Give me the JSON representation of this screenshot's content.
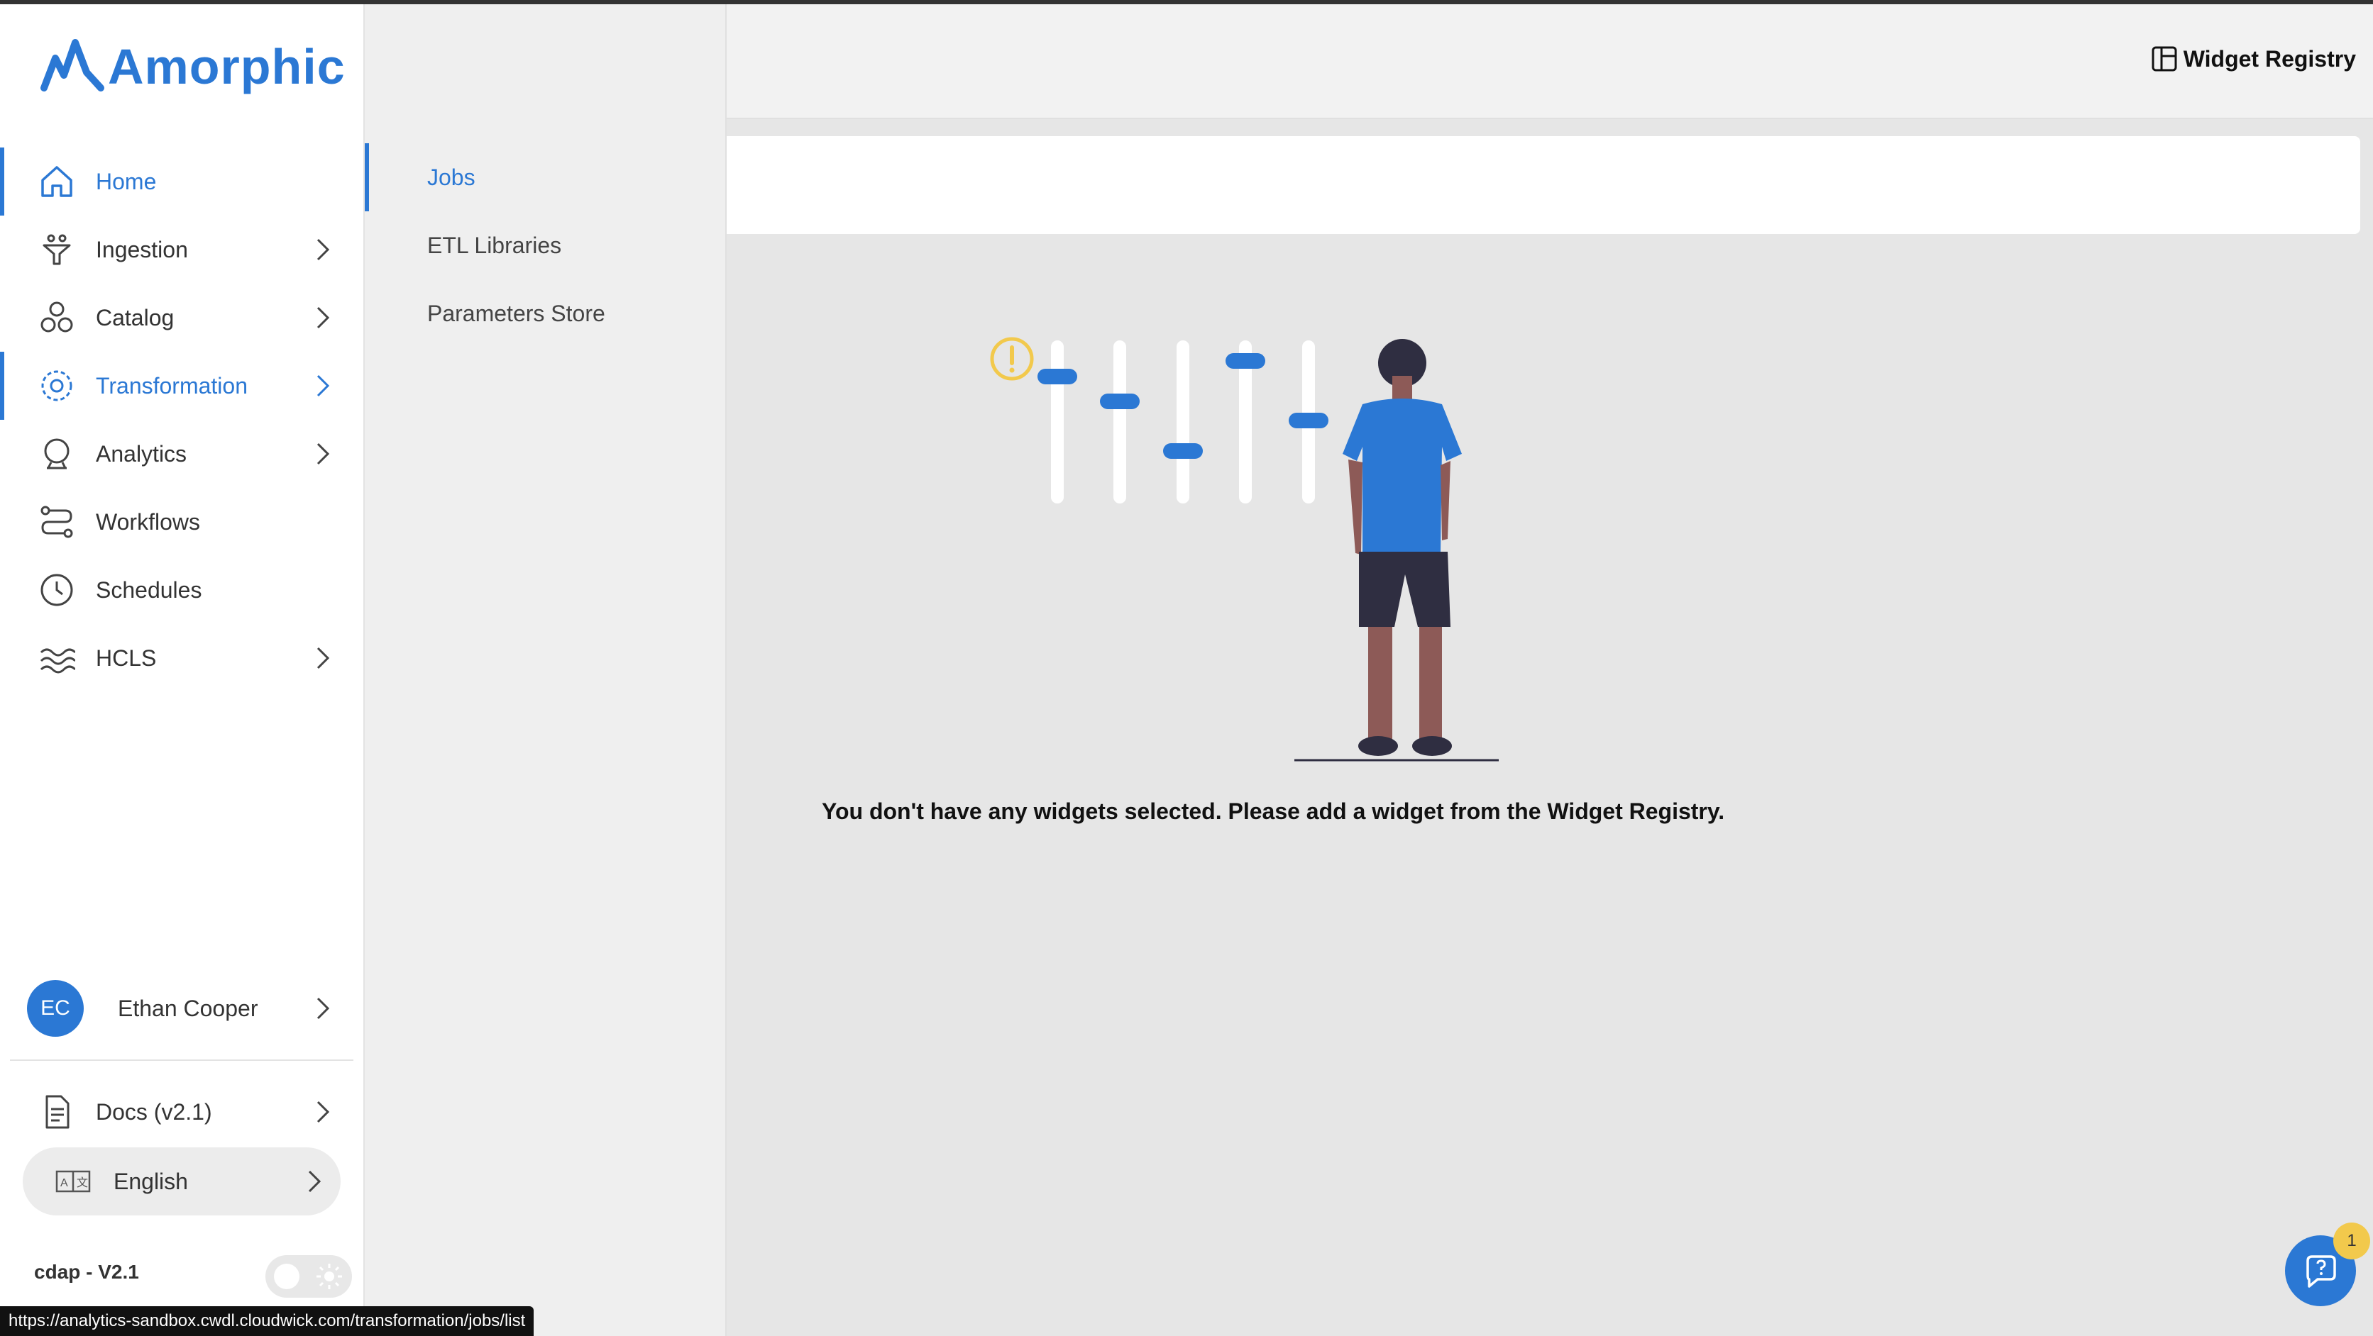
{
  "app": {
    "logo_text": "Amorphic",
    "brand_color": "#2b78d4"
  },
  "sidebar": {
    "items": [
      {
        "label": "Home",
        "icon": "home-icon",
        "active": true,
        "has_chevron": false
      },
      {
        "label": "Ingestion",
        "icon": "ingestion-icon",
        "active": false,
        "has_chevron": true
      },
      {
        "label": "Catalog",
        "icon": "catalog-icon",
        "active": false,
        "has_chevron": true
      },
      {
        "label": "Transformation",
        "icon": "transformation-icon",
        "active": true,
        "has_chevron": true
      },
      {
        "label": "Analytics",
        "icon": "analytics-icon",
        "active": false,
        "has_chevron": true
      },
      {
        "label": "Workflows",
        "icon": "workflows-icon",
        "active": false,
        "has_chevron": false
      },
      {
        "label": "Schedules",
        "icon": "clock-icon",
        "active": false,
        "has_chevron": false
      },
      {
        "label": "HCLS",
        "icon": "waves-icon",
        "active": false,
        "has_chevron": true
      }
    ],
    "user": {
      "initials": "EC",
      "name": "Ethan Cooper"
    },
    "docs_label": "Docs (v2.1)",
    "language_label": "English",
    "version_label": "cdap - V2.1"
  },
  "subnav": {
    "items": [
      {
        "label": "Jobs",
        "active": true
      },
      {
        "label": "ETL Libraries",
        "active": false
      },
      {
        "label": "Parameters Store",
        "active": false
      }
    ]
  },
  "header": {
    "widget_registry_label": "Widget Registry"
  },
  "main": {
    "empty_message": "You don't have any widgets selected. Please add a widget from the Widget Registry."
  },
  "status_bar": {
    "url": "https://analytics-sandbox.cwdl.cloudwick.com/transformation/jobs/list"
  },
  "help": {
    "badge_count": "1"
  }
}
